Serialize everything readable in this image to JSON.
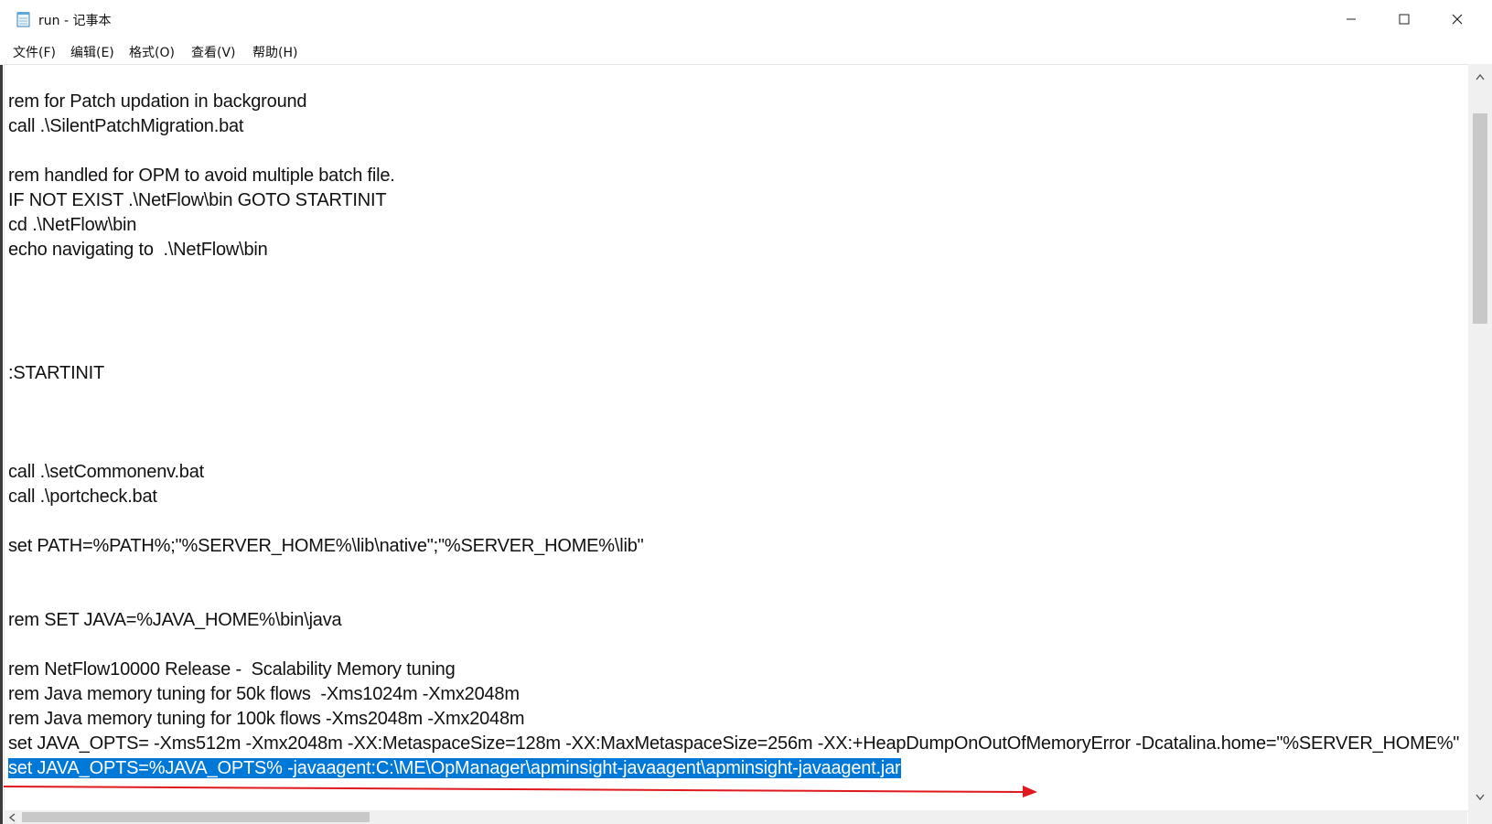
{
  "window": {
    "title": "run - 记事本",
    "controls": [
      "minimize",
      "maximize",
      "close"
    ]
  },
  "menu": {
    "items": [
      "文件(F)",
      "编辑(E)",
      "格式(O)",
      "查看(V)",
      "帮助(H)"
    ]
  },
  "editor": {
    "lines": [
      "rem for Patch updation in background",
      "call .\\SilentPatchMigration.bat",
      "",
      "rem handled for OPM to avoid multiple batch file.",
      "IF NOT EXIST .\\NetFlow\\bin GOTO STARTINIT",
      "cd .\\NetFlow\\bin",
      "echo navigating to  .\\NetFlow\\bin",
      "",
      "",
      "",
      "",
      ":STARTINIT",
      "",
      "",
      "",
      "call .\\setCommonenv.bat",
      "call .\\portcheck.bat",
      "",
      "set PATH=%PATH%;\"%SERVER_HOME%\\lib\\native\";\"%SERVER_HOME%\\lib\"",
      "",
      "",
      "rem SET JAVA=%JAVA_HOME%\\bin\\java",
      "",
      "rem NetFlow10000 Release -  Scalability Memory tuning",
      "rem Java memory tuning for 50k flows  -Xms1024m -Xmx2048m",
      "rem Java memory tuning for 100k flows -Xms2048m -Xmx2048m",
      "set JAVA_OPTS= -Xms512m -Xmx2048m -XX:MetaspaceSize=128m -XX:MaxMetaspaceSize=256m -XX:+HeapDumpOnOutOfMemoryError -Dcatalina.home=\"%SERVER_HOME%\"",
      "set JAVA_OPTS=%JAVA_OPTS% -javaagent:C:\\ME\\OpManager\\apminsight-javaagent\\apminsight-javaagent.jar"
    ],
    "selected_line_index": 27
  },
  "annotation": {
    "arrow_color": "#e0191e"
  },
  "colors": {
    "selection": "#0078d7",
    "text": "#111111"
  }
}
